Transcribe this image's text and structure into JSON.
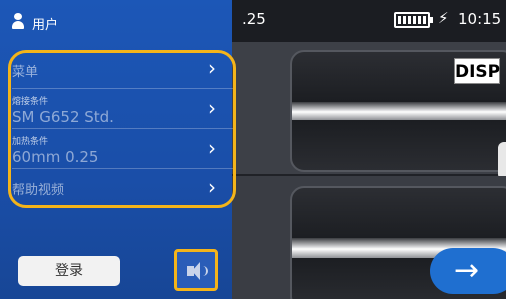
{
  "status": {
    "left_text": ".25",
    "charge_symbol": "⚡",
    "time": "10:15"
  },
  "device": {
    "disp_label": "DISP",
    "next_arrow": "→"
  },
  "menu": {
    "user_label": "用户",
    "items": [
      {
        "label": "菜单"
      },
      {
        "small_label": "熔接条件",
        "value": "SM G652 Std."
      },
      {
        "small_label": "加热条件",
        "value": "60mm 0.25"
      },
      {
        "label": "帮助视频"
      }
    ],
    "chevron": "›",
    "login_label": "登录",
    "sound_icon": "speaker-icon"
  },
  "colors": {
    "menu_blue": "#1c57b7",
    "highlight": "#f4b41a",
    "arrow_button": "#1f6fd0"
  }
}
